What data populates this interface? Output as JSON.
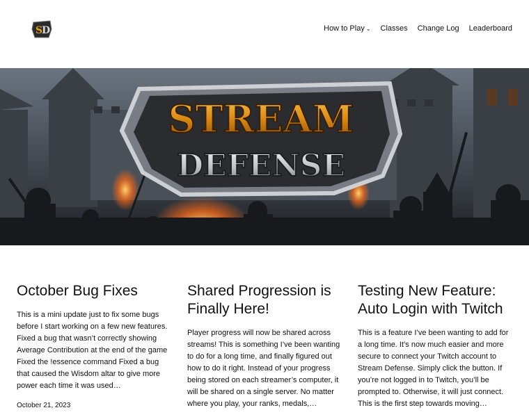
{
  "nav": {
    "items": [
      {
        "label": "How to Play",
        "has_dropdown": true
      },
      {
        "label": "Classes"
      },
      {
        "label": "Change Log"
      },
      {
        "label": "Leaderboard"
      }
    ]
  },
  "hero": {
    "logo_line1": "STREAM",
    "logo_line2": "DEFENSE"
  },
  "posts": [
    {
      "title": "October Bug Fixes",
      "excerpt": "This is a mini update just to fix some bugs before I start working on a few new features. Fixed a bug that wasn’t correctly showing Average Contribution at the end of the game Fixed the !essence command Fixed a bug that caused the Wisdom altar to give more power each time it was used…",
      "date": "October 21, 2023"
    },
    {
      "title": "Shared Progression is Finally Here!",
      "excerpt": "Player progress will now be shared across streams! This is something I’ve been wanting to do for a long time, and finally figured out how to do it right. Instead of your progress being stored on each streamer’s computer, it will be shared on a single server. No matter where you play, your ranks, medals,…",
      "date": ""
    },
    {
      "title": "Testing New Feature: Auto Login with Twitch",
      "excerpt": "This is a feature I’ve been wanting to add for a long time. It’s now much easier and more secure to connect your Twitch account to Stream Defense. Simply click the button. If you’re not logged in to Twitch, you’ll be prompted to. Otherwise, it will just connect. This is the first step towards moving…",
      "date": ""
    }
  ]
}
